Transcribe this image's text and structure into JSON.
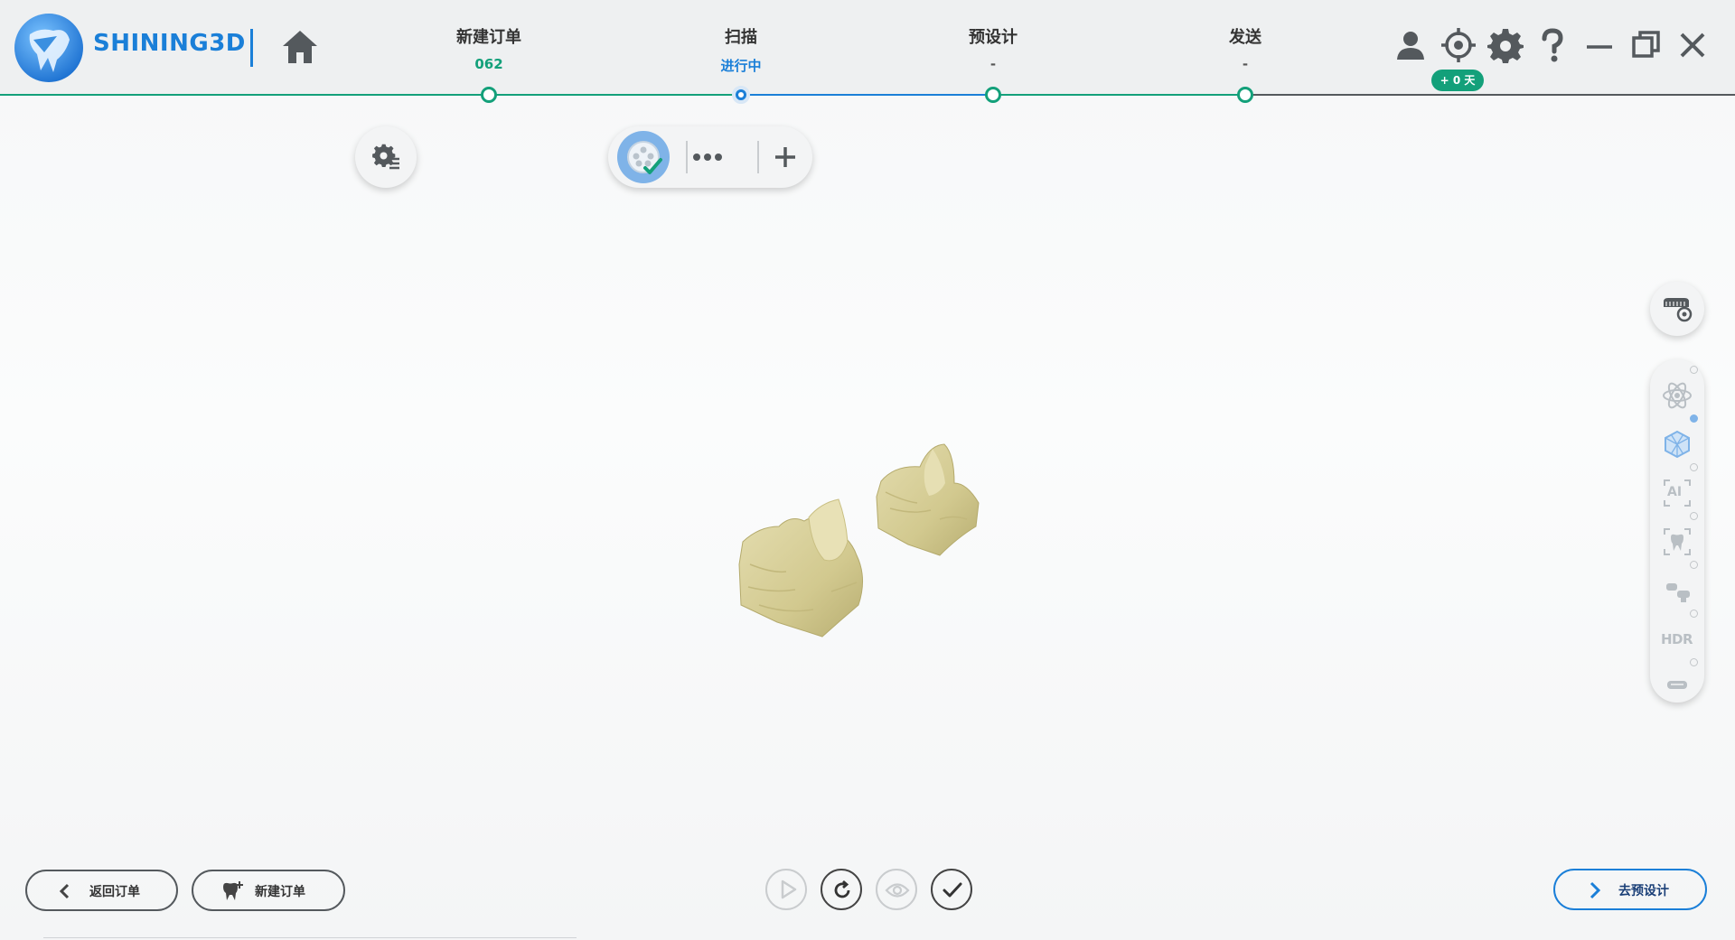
{
  "header": {
    "brand": "SHINING3D",
    "steps": [
      {
        "title": "新建订单",
        "value": "062",
        "value_color": "#13a07a"
      },
      {
        "title": "扫描",
        "value": "进行中",
        "value_color": "#1a7fd8"
      },
      {
        "title": "预设计",
        "value": "-",
        "value_color": "#555555"
      },
      {
        "title": "发送",
        "value": "-",
        "value_color": "#555555"
      }
    ],
    "days_badge": "+ 0 天"
  },
  "colors": {
    "accent_blue": "#1a7fd8",
    "progress_green": "#13a07a",
    "model_color": "#d6cf9a"
  },
  "icons": {
    "home": "home-icon",
    "user": "user-icon",
    "target": "crosshair-icon",
    "settings": "gear-icon",
    "help": "question-icon",
    "minimize": "minimize-icon",
    "restore": "restore-icon",
    "close": "close-icon"
  },
  "right_panel": {
    "items": [
      {
        "name": "atom-icon"
      },
      {
        "name": "cube-wireframe-icon",
        "active": true
      },
      {
        "name": "ai-icon",
        "label": "AI"
      },
      {
        "name": "tooth-view-icon"
      },
      {
        "name": "abutment-icon"
      },
      {
        "name": "hdr-icon",
        "label": "HDR"
      },
      {
        "name": "scan-body-icon"
      }
    ]
  },
  "bottom": {
    "back_label": "返回订单",
    "new_order_label": "新建订单",
    "next_label": "去预设计"
  }
}
